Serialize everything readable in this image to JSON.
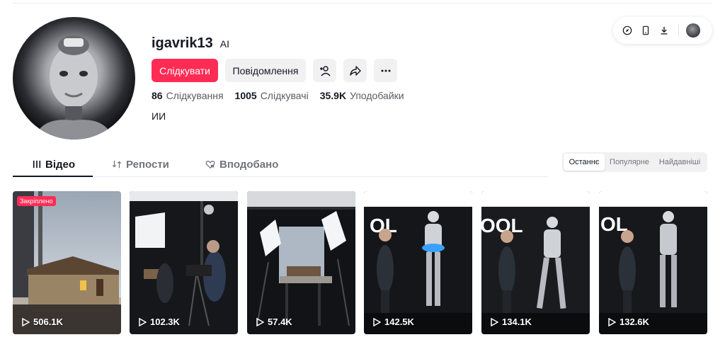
{
  "profile": {
    "username": "igavrik13",
    "badge": "AI",
    "bio": "ИИ",
    "follow_label": "Слідкувати",
    "message_label": "Повідомлення",
    "stats": [
      {
        "value": "86",
        "label": "Слідкування"
      },
      {
        "value": "1005",
        "label": "Слідкувачі"
      },
      {
        "value": "35.9K",
        "label": "Уподобайки"
      }
    ]
  },
  "tabs": [
    {
      "label": "Відео",
      "icon": "grid-icon"
    },
    {
      "label": "Репости",
      "icon": "repost-icon"
    },
    {
      "label": "Вподобано",
      "icon": "heart-lock-icon"
    }
  ],
  "sort_options": [
    "Останнє",
    "Популярне",
    "Найдавніші"
  ],
  "videos": [
    {
      "views": "506.1K",
      "pinned": "Закріплено",
      "scene": "house-on-set"
    },
    {
      "views": "102.3K",
      "scene": "film-crew"
    },
    {
      "views": "57.4K",
      "scene": "studio-lights"
    },
    {
      "views": "142.5K",
      "scene": "robot-stage"
    },
    {
      "views": "134.1K",
      "scene": "robot-stage"
    },
    {
      "views": "132.6K",
      "scene": "robot-stage"
    }
  ],
  "colors": {
    "accent": "#fe2c55",
    "text": "#161823",
    "muted": "#73747b"
  }
}
